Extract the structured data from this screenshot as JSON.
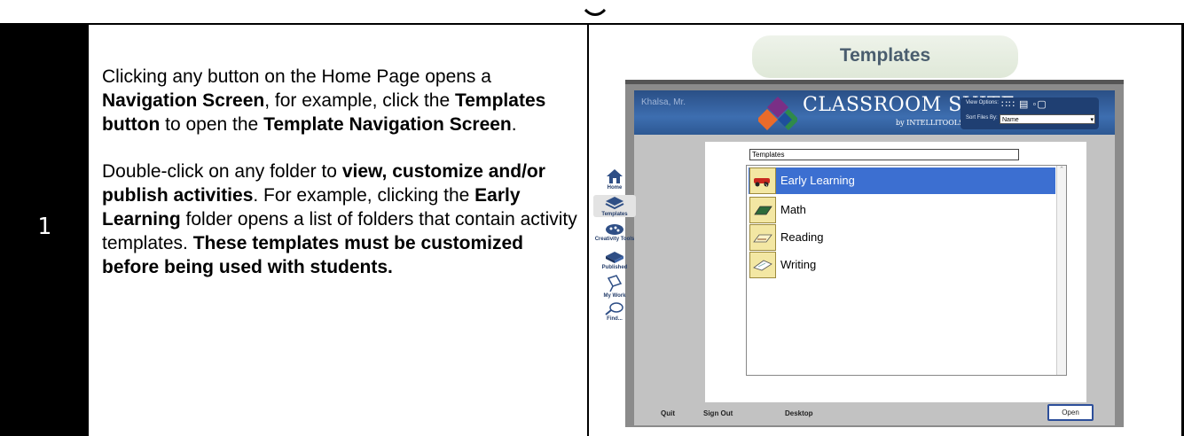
{
  "step_number": "1",
  "instructions": {
    "p1": {
      "t1": "Clicking any button on the Home Page opens a ",
      "b1": "Navigation Screen",
      "t2": ", for example, click the ",
      "b2": "Templates button",
      "t3": " to open the ",
      "b3": "Template Navigation Screen",
      "t4": "."
    },
    "p2": {
      "t1": "Double-click on any folder to ",
      "b1": "view, customize and/or publish activities",
      "t2": ". For example, clicking the ",
      "b2": "Early Learning",
      "t3": " folder opens a list of folders that contain activity templates.  ",
      "b3": "These templates must be customized before being used with students."
    }
  },
  "screenshot": {
    "label": "Templates",
    "user": "Khalsa, Mr.",
    "brand": "CLASSROOM SUITE",
    "brand_sub": "by INTELLITOOLS",
    "view_options_label": "View Options:",
    "sort_label": "Sort Files By:",
    "sort_value": "Name",
    "path": "Templates",
    "folders": [
      {
        "name": "Early Learning",
        "selected": true,
        "icon": "toy-car-icon"
      },
      {
        "name": "Math",
        "selected": false,
        "icon": "board-icon"
      },
      {
        "name": "Reading",
        "selected": false,
        "icon": "book-icon"
      },
      {
        "name": "Writing",
        "selected": false,
        "icon": "paper-icon"
      }
    ],
    "sidebar": [
      {
        "label": "Home",
        "icon": "house-icon"
      },
      {
        "label": "Templates",
        "icon": "stack-icon"
      },
      {
        "label": "Creativity Tools",
        "icon": "palette-icon"
      },
      {
        "label": "Published",
        "icon": "book-icon"
      },
      {
        "label": "My Work",
        "icon": "pages-icon"
      },
      {
        "label": "Find...",
        "icon": "magnifier-icon"
      }
    ],
    "footer": {
      "quit": "Quit",
      "sign_out": "Sign Out",
      "desktop": "Desktop",
      "open": "Open"
    },
    "colors": {
      "header_blue": "#3d6eb0",
      "selected_row": "#3c6fd1",
      "folder_fill": "#f3e7a3"
    }
  }
}
